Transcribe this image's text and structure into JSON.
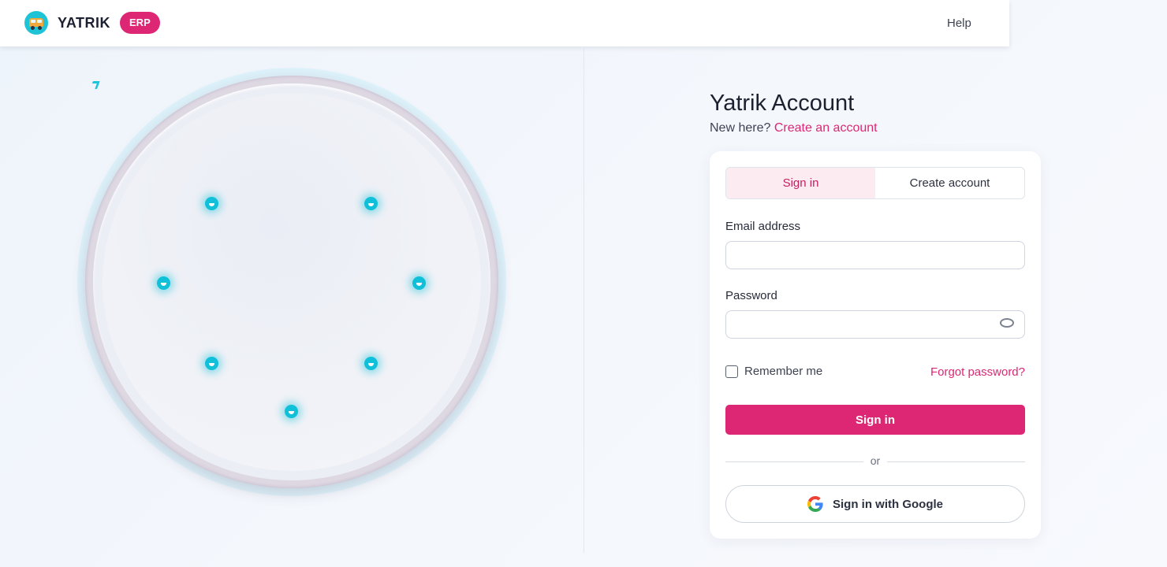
{
  "header": {
    "brand_name": "YATRIK",
    "badge": "ERP",
    "help_label": "Help"
  },
  "page": {
    "title": "Yatrik Account",
    "new_here": "New here?",
    "create_account_link": "Create an account"
  },
  "tabs": [
    {
      "label": "Sign in",
      "active": true
    },
    {
      "label": "Create account",
      "active": false
    }
  ],
  "form": {
    "email_label": "Email address",
    "email_value": "",
    "password_label": "Password",
    "password_value": "",
    "remember_label": "Remember me",
    "remember_checked": false,
    "forgot_label": "Forgot password?",
    "submit_label": "Sign in",
    "divider_text": "or",
    "google_label": "Sign in with Google"
  },
  "colors": {
    "accent": "#dd2774",
    "teal": "#10bfd8",
    "tab_active_bg": "#fcebf1"
  },
  "icons": {
    "logo": "bus-logo-icon",
    "password_toggle": "eye-icon",
    "google": "google-g-icon"
  }
}
